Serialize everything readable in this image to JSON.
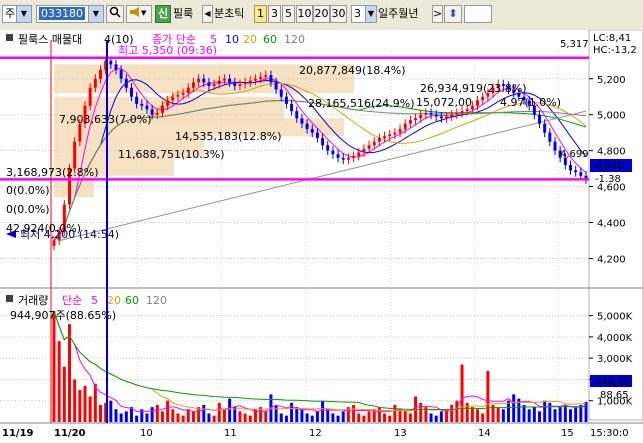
{
  "toolbar": {
    "market_label": "주",
    "code_value": "033180",
    "tab_label": "필룩",
    "sin_label": "신",
    "period_label": "분초틱",
    "period_buttons": [
      "1",
      "3",
      "5",
      "10",
      "20",
      "30"
    ],
    "active_period": "1",
    "interval_value": "3",
    "day_week_month_year": "일주월년",
    "nav_prev": "◀",
    "nav_next": ">",
    "updown_icon": "⬍",
    "search_icon": "search-icon",
    "speaker_icon": "speaker-icon"
  },
  "price_panel": {
    "legend": {
      "stock_name": "필룩스 매물대",
      "stock_param": "4(10)",
      "ma_label": "종가 단순",
      "ma_periods": [
        "5",
        "10",
        "20",
        "60",
        "120"
      ],
      "colors": {
        "stock_name": "#000000",
        "ma_label": "#ff00ff",
        "5": "#0000ff",
        "10": "#ff0000",
        "20": "#e0a000",
        "60": "#00a000",
        "120": "#808080"
      }
    },
    "high_label": "최고 5,350 (09:36)",
    "low_label": "최저 4,200 (14:54)",
    "volume_profile": [
      {
        "label": "20,877,849(18.4%)"
      },
      {
        "label": "26,934,919(23.8%)"
      },
      {
        "label": "28,165,516(24.9%)"
      },
      {
        "label": "15,072,00"
      },
      {
        "label": "4.97(1.0%)"
      },
      {
        "label": "7,903,633(7.0%)"
      },
      {
        "label": "14,535,183(12.8%)"
      },
      {
        "label": "11,688,751(10.3%)"
      },
      {
        "label": "3,168,973(2.8%)"
      },
      {
        "label": "0(0.0%)"
      },
      {
        "label": "0(0.0%)"
      },
      {
        "label": "42,924(0.0%)"
      }
    ],
    "right_top_value": "5,317",
    "right_low_value": "4,699",
    "lc_label": "LC:8,41",
    "hc_label": "HC:-13,2",
    "current_price": "4,640",
    "current_change": "-1.38",
    "y_ticks": [
      "5,200",
      "5,000",
      "4,800",
      "4,600",
      "4,400",
      "4,200"
    ],
    "hline_upper": 5317,
    "hline_lower": 4640
  },
  "volume_panel": {
    "legend": {
      "title": "거래량",
      "ma_label": "단순",
      "ma_periods": [
        "5",
        "20",
        "60",
        "120"
      ]
    },
    "max_label": "944,907주(88.65%)",
    "current_volume": "944,90",
    "current_pct": "88.65",
    "y_ticks": [
      "5,000K",
      "4,000K",
      "3,000K",
      "2,000K",
      "1,000K"
    ]
  },
  "x_axis": {
    "labels": [
      "11/19",
      "11/20",
      "10",
      "11",
      "12",
      "13",
      "14",
      "15",
      "15:30:0"
    ]
  },
  "chart_data": {
    "type": "candlestick",
    "price_range": [
      4080,
      5360
    ],
    "volume_range": [
      0,
      5500
    ],
    "volume_unit": "K",
    "hlines": [
      5317,
      4640
    ],
    "closes": [
      4300,
      4350,
      4500,
      4700,
      4850,
      4950,
      5050,
      5150,
      5200,
      5250,
      5300,
      5280,
      5250,
      5200,
      5150,
      5100,
      5060,
      5050,
      5030,
      5000,
      5010,
      5050,
      5080,
      5100,
      5110,
      5120,
      5150,
      5180,
      5200,
      5180,
      5160,
      5170,
      5190,
      5200,
      5180,
      5160,
      5170,
      5180,
      5190,
      5200,
      5210,
      5220,
      5180,
      5140,
      5100,
      5060,
      5020,
      4980,
      4950,
      4920,
      4900,
      4870,
      4830,
      4800,
      4780,
      4760,
      4750,
      4760,
      4770,
      4790,
      4810,
      4830,
      4850,
      4870,
      4880,
      4890,
      4900,
      4920,
      4950,
      4970,
      4980,
      5000,
      5010,
      5000,
      4990,
      4980,
      4990,
      5000,
      5010,
      5020,
      5030,
      5050,
      5080,
      5100,
      5120,
      5150,
      5170,
      5160,
      5140,
      5120,
      5100,
      5080,
      5050,
      5000,
      4950,
      4900,
      4850,
      4800,
      4760,
      4720,
      4690,
      4680,
      4660,
      4640
    ],
    "volumes": [
      5200,
      3800,
      2600,
      4600,
      2000,
      1500,
      1700,
      1200,
      1800,
      800,
      900,
      1000,
      600,
      400,
      500,
      700,
      300,
      600,
      400,
      700,
      800,
      500,
      1000,
      600,
      400,
      300,
      600,
      500,
      700,
      800,
      400,
      300,
      900,
      600,
      1100,
      700,
      500,
      400,
      300,
      600,
      700,
      500,
      1300,
      800,
      400,
      300,
      900,
      700,
      600,
      400,
      300,
      500,
      1000,
      600,
      400,
      300,
      500,
      700,
      800,
      400,
      300,
      500,
      600,
      700,
      400,
      300,
      800,
      600,
      500,
      400,
      1200,
      900,
      700,
      400,
      300,
      500,
      600,
      800,
      1000,
      2700,
      900,
      700,
      600,
      400,
      2400,
      800,
      700,
      600,
      1000,
      1300,
      1100,
      800,
      600,
      700,
      500,
      1000,
      900,
      600,
      700,
      800,
      600,
      700,
      800,
      945
    ]
  }
}
